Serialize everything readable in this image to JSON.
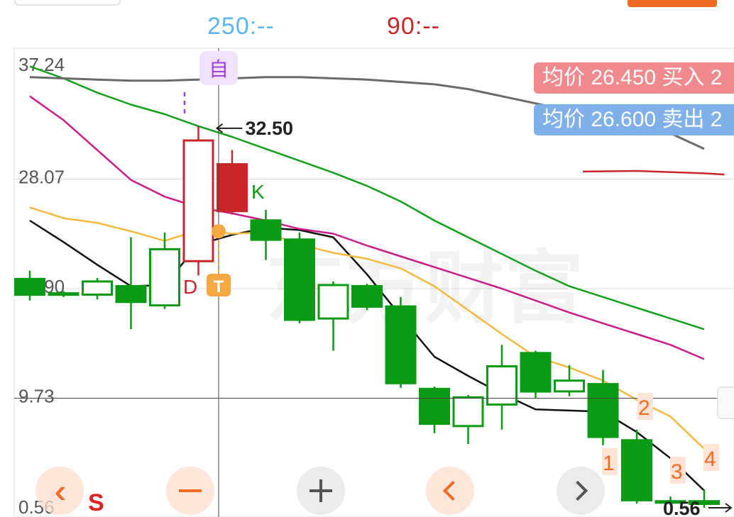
{
  "header": {
    "ma250_label": "250:--",
    "ma90_label": "90:--",
    "ma250_color": "#5bb5ee",
    "ma90_color": "#c8262b"
  },
  "price_tags": {
    "buy": "均价 26.450 买入 2",
    "sell": "均价 26.600 卖出 2",
    "buy_color": "#f08a8e",
    "sell_color": "#7fb0ea"
  },
  "toolbar": {
    "scroll_left_icon": "double-chevron-left-icon",
    "zoom_out_icon": "minus-icon",
    "zoom_in_icon": "plus-icon",
    "prev_icon": "chevron-left-icon",
    "next_icon": "chevron-right-icon",
    "s_label": "S"
  },
  "chart_data": {
    "type": "candlestick",
    "y_axis_labels": [
      "37.24",
      "28.07",
      "18.90",
      "9.73",
      "0.56"
    ],
    "ylim": [
      0.56,
      37.24
    ],
    "grid": true,
    "watermark": "东方财富",
    "colors": {
      "up": "#c8262b",
      "down": "#0a9a14",
      "ma_black": "#111111",
      "ma_orange": "#f5b941",
      "ma_magenta": "#cc1c8a",
      "ma_green": "#11a11b",
      "ma_gray": "#6a6a6a",
      "ma_red": "#c8262b"
    },
    "candles": [
      {
        "open": 19.8,
        "close": 18.3,
        "high": 20.4,
        "low": 17.9,
        "style": "down"
      },
      {
        "open": 18.6,
        "close": 18.3,
        "high": 18.7,
        "low": 18.2,
        "style": "down"
      },
      {
        "open": 18.4,
        "close": 19.5,
        "high": 19.8,
        "low": 18.0,
        "style": "hollow"
      },
      {
        "open": 19.2,
        "close": 17.7,
        "high": 23.2,
        "low": 15.5,
        "style": "down"
      },
      {
        "open": 17.5,
        "close": 22.2,
        "high": 23.6,
        "low": 17.2,
        "style": "hollow"
      },
      {
        "open": 21.2,
        "close": 31.3,
        "high": 32.5,
        "low": 20.0,
        "style": "hollow"
      },
      {
        "open": 29.4,
        "close": 25.3,
        "high": 30.5,
        "low": 25.1,
        "style": "up"
      },
      {
        "open": 24.7,
        "close": 22.9,
        "high": 25.5,
        "low": 21.3,
        "style": "down"
      },
      {
        "open": 23.1,
        "close": 16.2,
        "high": 23.6,
        "low": 16.0,
        "style": "down"
      },
      {
        "open": 16.4,
        "close": 19.2,
        "high": 19.5,
        "low": 13.7,
        "style": "hollow"
      },
      {
        "open": 19.2,
        "close": 17.3,
        "high": 19.3,
        "low": 17.1,
        "style": "down"
      },
      {
        "open": 17.5,
        "close": 10.9,
        "high": 18.2,
        "low": 10.6,
        "style": "down"
      },
      {
        "open": 10.6,
        "close": 7.5,
        "high": 10.7,
        "low": 6.8,
        "style": "down"
      },
      {
        "open": 7.4,
        "close": 9.8,
        "high": 10.0,
        "low": 5.9,
        "style": "hollow"
      },
      {
        "open": 9.2,
        "close": 12.4,
        "high": 14.2,
        "low": 7.1,
        "style": "hollow"
      },
      {
        "open": 13.6,
        "close": 10.2,
        "high": 13.7,
        "low": 9.7,
        "style": "down"
      },
      {
        "open": 10.3,
        "close": 11.2,
        "high": 12.5,
        "low": 9.9,
        "style": "hollow"
      },
      {
        "open": 11.0,
        "close": 6.4,
        "high": 12.1,
        "low": 5.8,
        "style": "down"
      },
      {
        "open": 6.3,
        "close": 1.1,
        "high": 7.1,
        "low": 0.9,
        "style": "down"
      },
      {
        "open": 1.2,
        "close": 0.9,
        "high": 1.5,
        "low": 0.8,
        "style": "down"
      },
      {
        "open": 1.2,
        "close": 0.8,
        "high": 2.1,
        "low": 0.56,
        "style": "down"
      }
    ],
    "ma_lines": [
      {
        "color": "#111111",
        "points": [
          [
            0,
            24.6
          ],
          [
            1,
            22.8
          ],
          [
            2,
            20.9
          ],
          [
            3,
            19.1
          ],
          [
            4,
            19.2
          ],
          [
            5,
            22.6
          ],
          [
            6,
            23.4
          ],
          [
            7,
            24.0
          ],
          [
            8,
            23.8
          ],
          [
            9,
            23.2
          ],
          [
            10,
            20.1
          ],
          [
            11,
            16.6
          ],
          [
            12,
            13.2
          ],
          [
            13,
            11.6
          ],
          [
            14,
            10.1
          ],
          [
            15,
            8.8
          ],
          [
            16,
            8.7
          ],
          [
            17,
            8.6
          ],
          [
            18,
            6.9
          ],
          [
            19,
            4.7
          ],
          [
            20,
            2.0
          ]
        ]
      },
      {
        "color": "#f5b941",
        "points": [
          [
            0,
            25.7
          ],
          [
            1,
            24.8
          ],
          [
            2,
            24.4
          ],
          [
            3,
            23.7
          ],
          [
            4,
            22.9
          ],
          [
            5,
            23.8
          ],
          [
            6,
            23.5
          ],
          [
            7,
            23.6
          ],
          [
            8,
            22.6
          ],
          [
            9,
            21.9
          ],
          [
            10,
            21.4
          ],
          [
            11,
            20.6
          ],
          [
            12,
            19.1
          ],
          [
            13,
            17.1
          ],
          [
            14,
            15.1
          ],
          [
            15,
            13.2
          ],
          [
            16,
            12.3
          ],
          [
            17,
            11.2
          ],
          [
            18,
            9.6
          ],
          [
            19,
            8.2
          ],
          [
            20,
            5.5
          ]
        ]
      },
      {
        "color": "#cc1c8a",
        "points": [
          [
            0,
            35.0
          ],
          [
            1,
            33.0
          ],
          [
            2,
            30.5
          ],
          [
            3,
            28.0
          ],
          [
            4,
            26.6
          ],
          [
            5,
            25.7
          ],
          [
            6,
            25.2
          ],
          [
            7,
            24.6
          ],
          [
            8,
            23.9
          ],
          [
            9,
            23.5
          ],
          [
            10,
            22.5
          ],
          [
            11,
            21.6
          ],
          [
            12,
            20.7
          ],
          [
            13,
            19.8
          ],
          [
            14,
            18.9
          ],
          [
            15,
            17.9
          ],
          [
            16,
            16.9
          ],
          [
            17,
            16.0
          ],
          [
            18,
            15.1
          ],
          [
            19,
            14.2
          ],
          [
            20,
            13.0
          ]
        ]
      },
      {
        "color": "#11a11b",
        "points": [
          [
            0,
            37.5
          ],
          [
            1,
            36.5
          ],
          [
            2,
            35.3
          ],
          [
            3,
            34.3
          ],
          [
            4,
            33.5
          ],
          [
            5,
            32.5
          ],
          [
            6,
            31.6
          ],
          [
            7,
            30.6
          ],
          [
            8,
            29.6
          ],
          [
            9,
            28.6
          ],
          [
            10,
            27.5
          ],
          [
            11,
            26.2
          ],
          [
            12,
            24.6
          ],
          [
            13,
            23.2
          ],
          [
            14,
            21.8
          ],
          [
            15,
            20.4
          ],
          [
            16,
            19.1
          ],
          [
            17,
            18.2
          ],
          [
            18,
            17.3
          ],
          [
            19,
            16.4
          ],
          [
            20,
            15.5
          ]
        ]
      },
      {
        "color": "#6a6a6a",
        "points": [
          [
            0,
            36.6
          ],
          [
            1,
            36.5
          ],
          [
            2,
            36.4
          ],
          [
            3,
            36.3
          ],
          [
            4,
            36.3
          ],
          [
            5,
            36.4
          ],
          [
            6,
            36.5
          ],
          [
            7,
            36.6
          ],
          [
            8,
            36.6
          ],
          [
            9,
            36.5
          ],
          [
            10,
            36.4
          ],
          [
            11,
            36.2
          ],
          [
            12,
            36.0
          ],
          [
            13,
            35.6
          ],
          [
            14,
            35.0
          ],
          [
            15,
            34.4
          ],
          [
            16,
            33.8
          ],
          [
            17,
            33.1
          ],
          [
            18,
            32.4
          ],
          [
            19,
            31.9
          ],
          [
            20,
            30.6
          ]
        ]
      },
      {
        "color": "#c8262b",
        "points": [
          [
            16.4,
            28.7
          ],
          [
            18,
            28.75
          ],
          [
            20,
            28.55
          ],
          [
            20.6,
            28.45
          ]
        ],
        "partial": true
      }
    ],
    "annotations": {
      "high_label": "32.50",
      "low_label": "0.56",
      "zi_label": "自",
      "d_label": "D",
      "k_label": "K",
      "t_label": "T",
      "n1": "1",
      "n2": "2",
      "n3": "3",
      "n4": "4"
    },
    "crosshair": {
      "candle": 5.6,
      "price": 9.73
    }
  }
}
